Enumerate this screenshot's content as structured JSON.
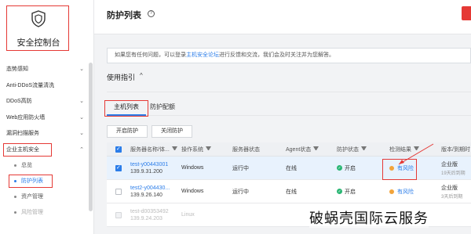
{
  "sidebar": {
    "brand_title": "安全控制台",
    "menu": [
      {
        "label": "态势感知"
      },
      {
        "label": "Anti-DDoS流量清洗"
      },
      {
        "label": "DDoS高防"
      },
      {
        "label": "Web应用防火墙"
      },
      {
        "label": "漏洞扫描服务"
      },
      {
        "label": "企业主机安全"
      }
    ],
    "submenu": [
      {
        "label": "总览"
      },
      {
        "label": "防护列表"
      },
      {
        "label": "资产管理"
      },
      {
        "label": "风险管理"
      }
    ]
  },
  "header": {
    "title": "防护列表",
    "help": "?"
  },
  "notice": {
    "prefix": "如果您有任何问题，可以登录",
    "link": "主机安全论坛",
    "suffix": "进行反馈和交流，我们会及时关注并为您解答。"
  },
  "guide": {
    "title": "使用指引",
    "chevron": "^"
  },
  "tabs": [
    {
      "label": "主机列表"
    },
    {
      "label": "防护配额"
    }
  ],
  "actions": {
    "enable": "开启防护",
    "disable": "关闭防护"
  },
  "table": {
    "headers": {
      "name": "服务器名称/体...",
      "os": "操作系统",
      "status": "服务器状态",
      "agent": "Agent状态",
      "protection": "防护状态",
      "result": "检测结果",
      "version": "版本/到期时"
    },
    "rows": [
      {
        "id": "test-y00443001",
        "ip": "139.9.31.200",
        "os": "Windows",
        "status": "运行中",
        "agent": "在线",
        "protection": "开启",
        "result": "有风险",
        "version": "企业版",
        "version_sub": "19天后到期"
      },
      {
        "id": "test2-y004430...",
        "ip": "139.9.26.140",
        "os": "Windows",
        "status": "运行中",
        "agent": "在线",
        "protection": "开启",
        "result": "有风险",
        "version": "企业版",
        "version_sub": "3天后到期"
      },
      {
        "id": "test-d00353492",
        "ip": "139.9.24.203",
        "os": "Linux",
        "status": "运行中",
        "agent": "",
        "protection": "",
        "result": "",
        "version": "",
        "version_sub": ""
      }
    ]
  },
  "watermark": "破蜗壳国际云服务",
  "colors": {
    "accent": "#2b7de9",
    "highlight_box": "#e53935",
    "ok": "#2bb674",
    "risk": "#f2a43a"
  }
}
